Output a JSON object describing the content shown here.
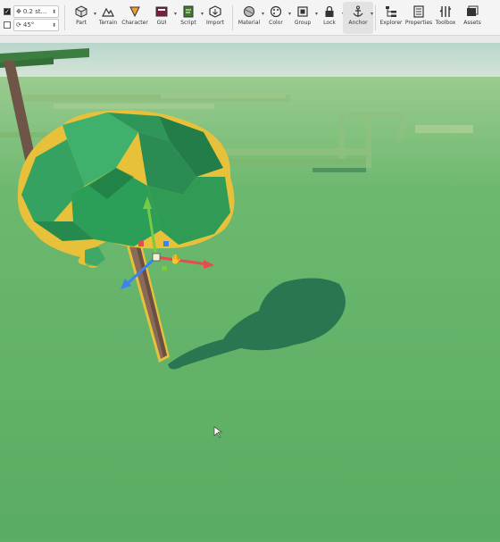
{
  "snap": {
    "move_value": "0.2 st...",
    "rotate_value": "45°",
    "move_checked": true,
    "rotate_checked": false
  },
  "toolbar": {
    "part": "Part",
    "terrain": "Terrain",
    "character": "Character",
    "gui": "GUI",
    "script": "Script",
    "import": "Import",
    "material": "Material",
    "color": "Color",
    "group": "Group",
    "lock": "Lock",
    "anchor": "Anchor",
    "explorer": "Explorer",
    "properties": "Properties",
    "toolbox": "Toolbox",
    "assets": "Assets"
  },
  "icons": {
    "move": "move-icon",
    "rotate": "rotate-icon",
    "part": "cube-icon",
    "terrain": "mountain-icon",
    "character": "character-icon",
    "gui": "gui-icon",
    "script": "script-icon",
    "import": "import-icon",
    "material": "material-icon",
    "color": "palette-icon",
    "group": "group-icon",
    "lock": "lock-icon",
    "anchor": "anchor-icon",
    "explorer": "explorer-icon",
    "properties": "properties-icon",
    "toolbox": "toolbox-icon",
    "assets": "assets-icon"
  },
  "colors": {
    "sky": "#c7dcd4",
    "ground": "#5fae66",
    "foliage": "#2f9a55",
    "trunk": "#8a6a58",
    "selection": "#e8c13a",
    "gizmo_x": "#e84b4b",
    "gizmo_y": "#7ac943",
    "gizmo_z": "#3b82f6",
    "shadow": "#1f6b4c"
  }
}
